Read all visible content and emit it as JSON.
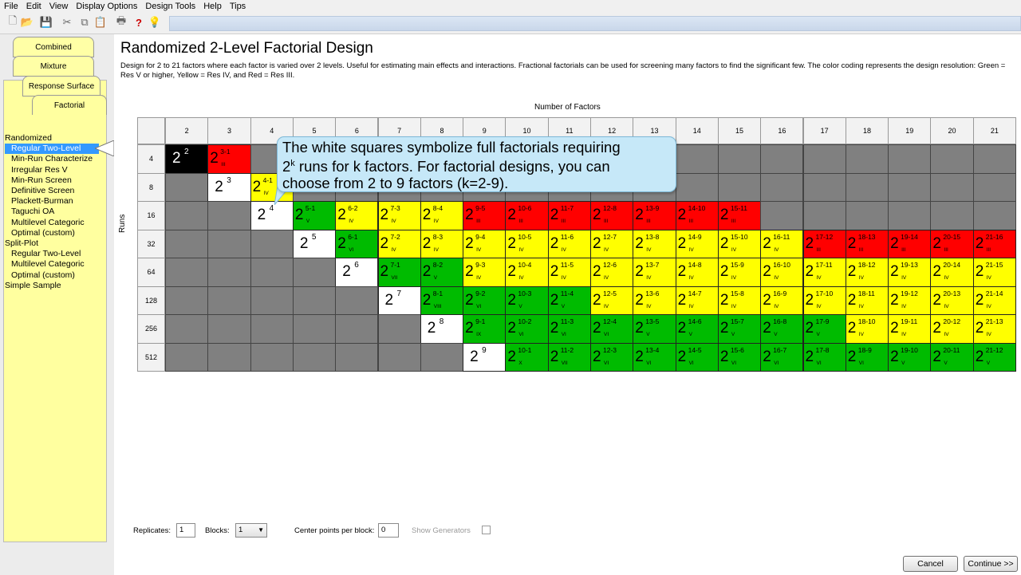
{
  "menu": [
    "File",
    "Edit",
    "View",
    "Display Options",
    "Design Tools",
    "Help",
    "Tips"
  ],
  "toolbar": {
    "icons": [
      "new-document-icon",
      "open-folder-icon",
      "save-icon",
      "cut-icon",
      "copy-icon",
      "paste-icon",
      "print-icon",
      "help-question-icon",
      "tip-lightbulb-icon"
    ],
    "glyphs": [
      "🗋",
      "📂",
      "💾",
      "✂",
      "⧉",
      "📋",
      "🖶",
      "?",
      "💡"
    ]
  },
  "tabs": [
    "Combined",
    "Mixture",
    "Response Surface",
    "Factorial"
  ],
  "tree": {
    "randomized": "Randomized",
    "randomized_items": [
      "Regular Two-Level",
      "Min-Run Characterize",
      "Irregular Res V",
      "Min-Run Screen",
      "Definitive Screen",
      "Plackett-Burman",
      "Taguchi OA",
      "Multilevel Categoric",
      "Optimal (custom)"
    ],
    "split_plot": "Split-Plot",
    "split_items": [
      "Regular Two-Level",
      "Multilevel Categoric",
      "Optimal (custom)"
    ],
    "simple_sample": "Simple Sample"
  },
  "page": {
    "title": "Randomized 2-Level Factorial Design",
    "description": "Design for 2 to 21 factors where each factor is varied over 2 levels.  Useful for estimating main effects and interactions.  Fractional factorials can be used for screening many factors to find the significant few. The color coding represents the design resolution: Green = Res V or higher, Yellow = Res IV, and Red = Res III."
  },
  "grid": {
    "factors_label": "Number of Factors",
    "runs_label": "Runs",
    "factors": [
      "2",
      "3",
      "4",
      "5",
      "6",
      "7",
      "8",
      "9",
      "10",
      "11",
      "12",
      "13",
      "14",
      "15",
      "16",
      "17",
      "18",
      "19",
      "20",
      "21"
    ],
    "runs": [
      "4",
      "8",
      "16",
      "32",
      "64",
      "128",
      "256",
      "512"
    ],
    "rows": [
      [
        [
          "K",
          "2",
          "",
          ""
        ],
        [
          "R",
          "3-1",
          "III"
        ],
        [
          "g"
        ],
        [
          "g"
        ],
        [
          "g"
        ],
        [
          "g"
        ],
        [
          "g"
        ],
        [
          "g"
        ],
        [
          "g"
        ],
        [
          "g"
        ],
        [
          "g"
        ],
        [
          "g"
        ],
        [
          "g"
        ],
        [
          "g"
        ],
        [
          "g"
        ],
        [
          "g"
        ],
        [
          "g"
        ],
        [
          "g"
        ],
        [
          "g"
        ],
        [
          "g"
        ]
      ],
      [
        [
          "g"
        ],
        [
          "W",
          "3",
          ""
        ],
        [
          "Y",
          "4-1",
          "IV"
        ],
        [
          "g"
        ],
        [
          "g"
        ],
        [
          "g"
        ],
        [
          "g"
        ],
        [
          "g"
        ],
        [
          "g"
        ],
        [
          "g"
        ],
        [
          "g"
        ],
        [
          "g"
        ],
        [
          "g"
        ],
        [
          "g"
        ],
        [
          "g"
        ],
        [
          "g"
        ],
        [
          "g"
        ],
        [
          "g"
        ],
        [
          "g"
        ],
        [
          "g"
        ]
      ],
      [
        [
          "g"
        ],
        [
          "g"
        ],
        [
          "W",
          "4",
          ""
        ],
        [
          "G",
          "5-1",
          "V"
        ],
        [
          "Y",
          "6-2",
          "IV"
        ],
        [
          "Y",
          "7-3",
          "IV"
        ],
        [
          "Y",
          "8-4",
          "IV"
        ],
        [
          "R",
          "9-5",
          "III"
        ],
        [
          "R",
          "10-6",
          "III"
        ],
        [
          "R",
          "11-7",
          "III"
        ],
        [
          "R",
          "12-8",
          "III"
        ],
        [
          "R",
          "13-9",
          "III"
        ],
        [
          "R",
          "14-10",
          "III"
        ],
        [
          "R",
          "15-11",
          "III"
        ],
        [
          "g"
        ],
        [
          "g"
        ],
        [
          "g"
        ],
        [
          "g"
        ],
        [
          "g"
        ],
        [
          "g"
        ]
      ],
      [
        [
          "g"
        ],
        [
          "g"
        ],
        [
          "g"
        ],
        [
          "W",
          "5",
          ""
        ],
        [
          "G",
          "6-1",
          "VI"
        ],
        [
          "Y",
          "7-2",
          "IV"
        ],
        [
          "Y",
          "8-3",
          "IV"
        ],
        [
          "Y",
          "9-4",
          "IV"
        ],
        [
          "Y",
          "10-5",
          "IV"
        ],
        [
          "Y",
          "11-6",
          "IV"
        ],
        [
          "Y",
          "12-7",
          "IV"
        ],
        [
          "Y",
          "13-8",
          "IV"
        ],
        [
          "Y",
          "14-9",
          "IV"
        ],
        [
          "Y",
          "15-10",
          "IV"
        ],
        [
          "Y",
          "16-11",
          "IV"
        ],
        [
          "R",
          "17-12",
          "III"
        ],
        [
          "R",
          "18-13",
          "III"
        ],
        [
          "R",
          "19-14",
          "III"
        ],
        [
          "R",
          "20-15",
          "III"
        ],
        [
          "R",
          "21-16",
          "III"
        ]
      ],
      [
        [
          "g"
        ],
        [
          "g"
        ],
        [
          "g"
        ],
        [
          "g"
        ],
        [
          "W",
          "6",
          ""
        ],
        [
          "G",
          "7-1",
          "VII"
        ],
        [
          "G",
          "8-2",
          "V"
        ],
        [
          "Y",
          "9-3",
          "IV"
        ],
        [
          "Y",
          "10-4",
          "IV"
        ],
        [
          "Y",
          "11-5",
          "IV"
        ],
        [
          "Y",
          "12-6",
          "IV"
        ],
        [
          "Y",
          "13-7",
          "IV"
        ],
        [
          "Y",
          "14-8",
          "IV"
        ],
        [
          "Y",
          "15-9",
          "IV"
        ],
        [
          "Y",
          "16-10",
          "IV"
        ],
        [
          "Y",
          "17-11",
          "IV"
        ],
        [
          "Y",
          "18-12",
          "IV"
        ],
        [
          "Y",
          "19-13",
          "IV"
        ],
        [
          "Y",
          "20-14",
          "IV"
        ],
        [
          "Y",
          "21-15",
          "IV"
        ]
      ],
      [
        [
          "g"
        ],
        [
          "g"
        ],
        [
          "g"
        ],
        [
          "g"
        ],
        [
          "g"
        ],
        [
          "W",
          "7",
          ""
        ],
        [
          "G",
          "8-1",
          "VIII"
        ],
        [
          "G",
          "9-2",
          "VI"
        ],
        [
          "G",
          "10-3",
          "V"
        ],
        [
          "G",
          "11-4",
          "V"
        ],
        [
          "Y",
          "12-5",
          "IV"
        ],
        [
          "Y",
          "13-6",
          "IV"
        ],
        [
          "Y",
          "14-7",
          "IV"
        ],
        [
          "Y",
          "15-8",
          "IV"
        ],
        [
          "Y",
          "16-9",
          "IV"
        ],
        [
          "Y",
          "17-10",
          "IV"
        ],
        [
          "Y",
          "18-11",
          "IV"
        ],
        [
          "Y",
          "19-12",
          "IV"
        ],
        [
          "Y",
          "20-13",
          "IV"
        ],
        [
          "Y",
          "21-14",
          "IV"
        ]
      ],
      [
        [
          "g"
        ],
        [
          "g"
        ],
        [
          "g"
        ],
        [
          "g"
        ],
        [
          "g"
        ],
        [
          "g"
        ],
        [
          "W",
          "8",
          ""
        ],
        [
          "G",
          "9-1",
          "IX"
        ],
        [
          "G",
          "10-2",
          "VI"
        ],
        [
          "G",
          "11-3",
          "VI"
        ],
        [
          "G",
          "12-4",
          "VI"
        ],
        [
          "G",
          "13-5",
          "V"
        ],
        [
          "G",
          "14-6",
          "V"
        ],
        [
          "G",
          "15-7",
          "V"
        ],
        [
          "G",
          "16-8",
          "V"
        ],
        [
          "G",
          "17-9",
          "V"
        ],
        [
          "Y",
          "18-10",
          "IV"
        ],
        [
          "Y",
          "19-11",
          "IV"
        ],
        [
          "Y",
          "20-12",
          "IV"
        ],
        [
          "Y",
          "21-13",
          "IV"
        ]
      ],
      [
        [
          "g"
        ],
        [
          "g"
        ],
        [
          "g"
        ],
        [
          "g"
        ],
        [
          "g"
        ],
        [
          "g"
        ],
        [
          "g"
        ],
        [
          "W",
          "9",
          ""
        ],
        [
          "G",
          "10-1",
          "X"
        ],
        [
          "G",
          "11-2",
          "VII"
        ],
        [
          "G",
          "12-3",
          "VI"
        ],
        [
          "G",
          "13-4",
          "VI"
        ],
        [
          "G",
          "14-5",
          "VI"
        ],
        [
          "G",
          "15-6",
          "VI"
        ],
        [
          "G",
          "16-7",
          "VI"
        ],
        [
          "G",
          "17-8",
          "VI"
        ],
        [
          "G",
          "18-9",
          "VI"
        ],
        [
          "G",
          "19-10",
          "V"
        ],
        [
          "G",
          "20-11",
          "V"
        ],
        [
          "G",
          "21-12",
          "V"
        ]
      ]
    ]
  },
  "tooltip": {
    "line1": "The white squares symbolize full factorials requiring",
    "base": "2",
    "sup": "k",
    "line2_rest": " runs for k factors.  For factorial designs, you can",
    "line3": "choose from 2 to 9 factors (k=2-9)."
  },
  "controls": {
    "replicates_label": "Replicates:",
    "replicates_value": "1",
    "blocks_label": "Blocks:",
    "blocks_value": "1",
    "center_label": "Center points per block:",
    "center_value": "0",
    "show_generators_label": "Show Generators",
    "show_generators_checked": false
  },
  "buttons": {
    "cancel": "Cancel",
    "continue": "Continue >>"
  },
  "colors": {
    "res3": "#ff0000",
    "res4": "#ffff00",
    "res5plus": "#00bb00",
    "tooltip": "#c6e8f8",
    "selection": "#3399ff"
  }
}
